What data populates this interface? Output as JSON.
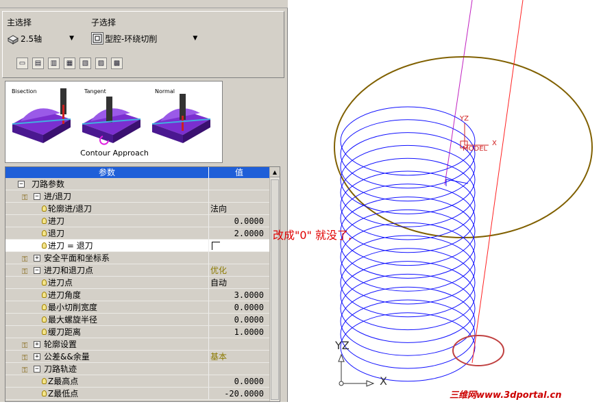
{
  "selection": {
    "main_label": "主选择",
    "sub_label": "子选择",
    "main_value": "2.5轴",
    "sub_value": "型腔-环绕切削",
    "toolbar_icons": [
      "open-file-icon",
      "load-icon",
      "database-icon",
      "save-icon",
      "export-icon",
      "filter-icon",
      "tool-icon"
    ]
  },
  "approach": {
    "caption": "Contour Approach",
    "labels": [
      "Bisection",
      "Tangent",
      "Normal"
    ]
  },
  "tree": {
    "header_param": "参数",
    "header_value": "值",
    "rows": [
      {
        "label": "刀路参数",
        "value": "",
        "kind": "group",
        "expand": "−"
      },
      {
        "label": "进/退刀",
        "value": "",
        "kind": "sub",
        "expand": "−"
      },
      {
        "label": "轮廓进/退刀",
        "value": "法向",
        "kind": "item"
      },
      {
        "label": "进刀",
        "value": "0.0000",
        "kind": "item",
        "fx": true
      },
      {
        "label": "退刀",
        "value": "2.0000",
        "kind": "item",
        "fx": true
      },
      {
        "label": "进刀 = 退刀",
        "value": "",
        "kind": "item",
        "checkbox": true,
        "selected": true
      },
      {
        "label": "安全平面和坐标系",
        "value": "",
        "kind": "sub",
        "expand": "+"
      },
      {
        "label": "进刀和退刀点",
        "value": "优化",
        "kind": "sub",
        "expand": "−",
        "olive": true
      },
      {
        "label": "进刀点",
        "value": "自动",
        "kind": "item"
      },
      {
        "label": "进刀角度",
        "value": "3.0000",
        "kind": "item",
        "fx": true
      },
      {
        "label": "最小切削宽度",
        "value": "0.0000",
        "kind": "item",
        "fx": true
      },
      {
        "label": "最大螺旋半径",
        "value": "0.0000",
        "kind": "item",
        "fx": true
      },
      {
        "label": "缓刀距离",
        "value": "1.0000",
        "kind": "item",
        "fx": true
      },
      {
        "label": "轮廓设置",
        "value": "",
        "kind": "sub",
        "expand": "+"
      },
      {
        "label": "公差&&余量",
        "value": "基本",
        "kind": "sub",
        "expand": "+",
        "olive": true
      },
      {
        "label": "刀路轨迹",
        "value": "",
        "kind": "sub",
        "expand": "−"
      },
      {
        "label": "Z最高点",
        "value": "0.0000",
        "kind": "item",
        "fx": true
      },
      {
        "label": "Z最低点",
        "value": "-20.0000",
        "kind": "item",
        "fx": true
      }
    ]
  },
  "annotation": "改成\"0\" 就没了,",
  "viewport": {
    "model_axis_yz": "YZ",
    "model_axis_x": "X",
    "model_label": "MODEL",
    "corner_axis_yz": "YZ",
    "corner_axis_x": "X"
  },
  "watermark": "三维网www.3dportal.cn",
  "colors": {
    "selection_blue": "#1f5fd8",
    "helix": "#1010ff",
    "ellipse": "#806000",
    "annotation": "#e00000"
  }
}
